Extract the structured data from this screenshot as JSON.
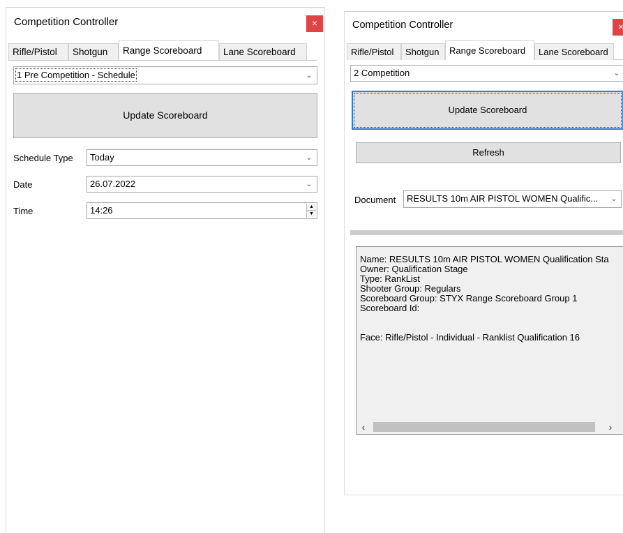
{
  "left": {
    "title": "Competition Controller",
    "close": "×",
    "tabs": [
      "Rifle/Pistol",
      "Shotgun",
      "Range Scoreboard",
      "Lane Scoreboard"
    ],
    "active_tab": "Range Scoreboard",
    "mode_select": "1 Pre Competition - Schedule",
    "update_button": "Update Scoreboard",
    "schedule_type_label": "Schedule Type",
    "schedule_type_value": "Today",
    "date_label": "Date",
    "date_value": "26.07.2022",
    "time_label": "Time",
    "time_value": "14:26"
  },
  "right": {
    "title": "Competition Controller",
    "close": "×",
    "tabs": [
      "Rifle/Pistol",
      "Shotgun",
      "Range Scoreboard",
      "Lane Scoreboard"
    ],
    "active_tab": "Range Scoreboard",
    "mode_select": "2 Competition",
    "update_button": "Update Scoreboard",
    "refresh_button": "Refresh",
    "document_label": "Document",
    "document_value": "RESULTS 10m AIR PISTOL WOMEN Qualific...",
    "details": [
      "Name: RESULTS 10m AIR PISTOL WOMEN Qualification Sta",
      "Owner: Qualification Stage",
      "Type: RankList",
      "Shooter Group: Regulars",
      "Scoreboard Group: STYX Range Scoreboard Group 1",
      "Scoreboard Id:",
      "",
      "Face: Rifle/Pistol - Individual - Ranklist Qualification 16"
    ]
  },
  "icons": {
    "close": "close-icon",
    "dropdown": "chevron-down-icon",
    "spin_up": "spin-up-icon",
    "spin_down": "spin-down-icon",
    "scroll_left": "scroll-left-icon",
    "scroll_right": "scroll-right-icon"
  },
  "colors": {
    "close_button": "#e04343",
    "focus_border": "#2b7ad6",
    "button_face": "#e1e1e1"
  }
}
